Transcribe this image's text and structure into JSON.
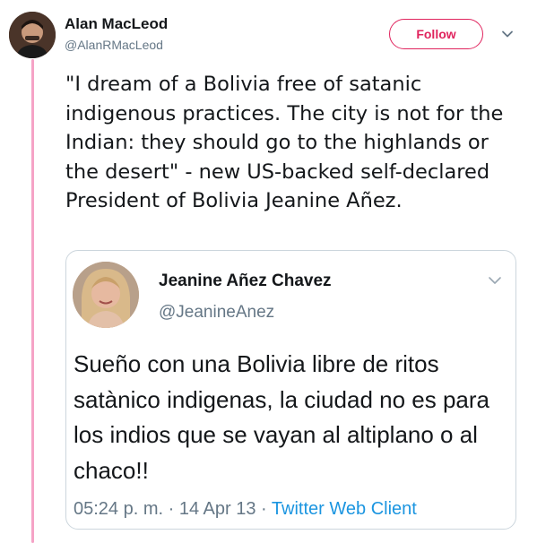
{
  "tweet": {
    "author_name": "Alan MacLeod",
    "author_handle": "@AlanRMacLeod",
    "follow_label": "Follow",
    "text": "\"I dream of a Bolivia free of satanic indigenous practices. The city is not for the Indian: they should go to the highlands or the desert\" - new US-backed self-declared President of Bolivia Jeanine Añez."
  },
  "quoted": {
    "name": "Jeanine Añez Chavez",
    "handle": "@JeanineAnez",
    "text": "Sueño con una Bolivia libre de ritos satànico indigenas, la ciudad no es para los indios que se vayan al altiplano o al chaco!!",
    "time": "05:24 p. m.",
    "date": "14 Apr 13",
    "separator": "·",
    "source": "Twitter Web Client"
  },
  "colors": {
    "follow_accent": "#e0245e",
    "thread_line": "#f5a3c6",
    "link_blue": "#1b95e0",
    "meta_gray": "#657786"
  },
  "icons": [
    "avatar",
    "chevron-down-icon"
  ]
}
